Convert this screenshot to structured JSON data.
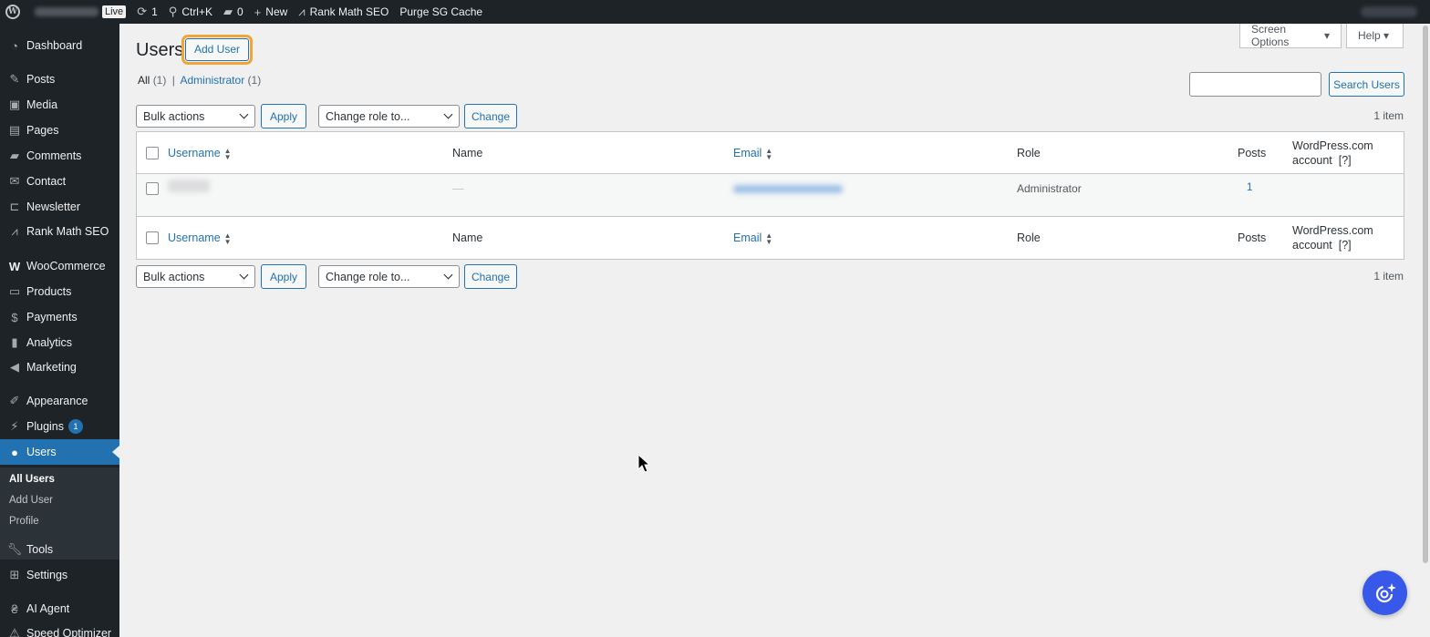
{
  "adminbar": {
    "live": "Live",
    "updates_count": "1",
    "search_shortcut": "Ctrl+K",
    "comments_count": "0",
    "new_label": "New",
    "rankmath_label": "Rank Math SEO",
    "purge_label": "Purge SG Cache"
  },
  "sidebar": {
    "items": [
      {
        "label": "Dashboard",
        "icon": "dashboard-icon"
      },
      {
        "label": "Posts",
        "icon": "pin-icon"
      },
      {
        "label": "Media",
        "icon": "media-icon"
      },
      {
        "label": "Pages",
        "icon": "pages-icon"
      },
      {
        "label": "Comments",
        "icon": "comment-icon"
      },
      {
        "label": "Contact",
        "icon": "mail-icon"
      },
      {
        "label": "Newsletter",
        "icon": "newsletter-icon"
      },
      {
        "label": "Rank Math SEO",
        "icon": "rankmath-icon"
      },
      {
        "label": "WooCommerce",
        "icon": "woo-icon"
      },
      {
        "label": "Products",
        "icon": "archive-icon"
      },
      {
        "label": "Payments",
        "icon": "dollar-icon"
      },
      {
        "label": "Analytics",
        "icon": "chart-icon"
      },
      {
        "label": "Marketing",
        "icon": "megaphone-icon"
      },
      {
        "label": "Appearance",
        "icon": "brush-icon"
      },
      {
        "label": "Plugins",
        "icon": "plugin-icon",
        "badge": "1"
      },
      {
        "label": "Users",
        "icon": "user-icon"
      },
      {
        "label": "Tools",
        "icon": "wrench-icon"
      },
      {
        "label": "Settings",
        "icon": "settings-icon"
      },
      {
        "label": "AI Agent",
        "icon": "ai-icon"
      },
      {
        "label": "Speed Optimizer",
        "icon": "speed-icon"
      }
    ],
    "users_submenu": [
      "All Users",
      "Add User",
      "Profile"
    ]
  },
  "header": {
    "screen_options": "Screen Options",
    "help": "Help",
    "title": "Users",
    "add_user": "Add User"
  },
  "filters": {
    "all_label": "All",
    "all_count": "(1)",
    "separator": "|",
    "admin_label": "Administrator",
    "admin_count": "(1)"
  },
  "search": {
    "button": "Search Users",
    "value": ""
  },
  "tablenav": {
    "bulk_actions": "Bulk actions",
    "apply": "Apply",
    "change_role": "Change role to...",
    "change": "Change",
    "items": "1 item"
  },
  "table": {
    "columns": {
      "username": "Username",
      "name": "Name",
      "email": "Email",
      "role": "Role",
      "posts": "Posts",
      "wpcom_line1": "WordPress.com",
      "wpcom_line2": "account",
      "wpcom_help": "[?]"
    },
    "rows": [
      {
        "username": "",
        "name": "—",
        "email": "",
        "role": "Administrator",
        "posts": "1"
      }
    ]
  },
  "colors": {
    "accent": "#2271b1",
    "sidebar": "#1d2327",
    "highlight": "#f0a636"
  }
}
